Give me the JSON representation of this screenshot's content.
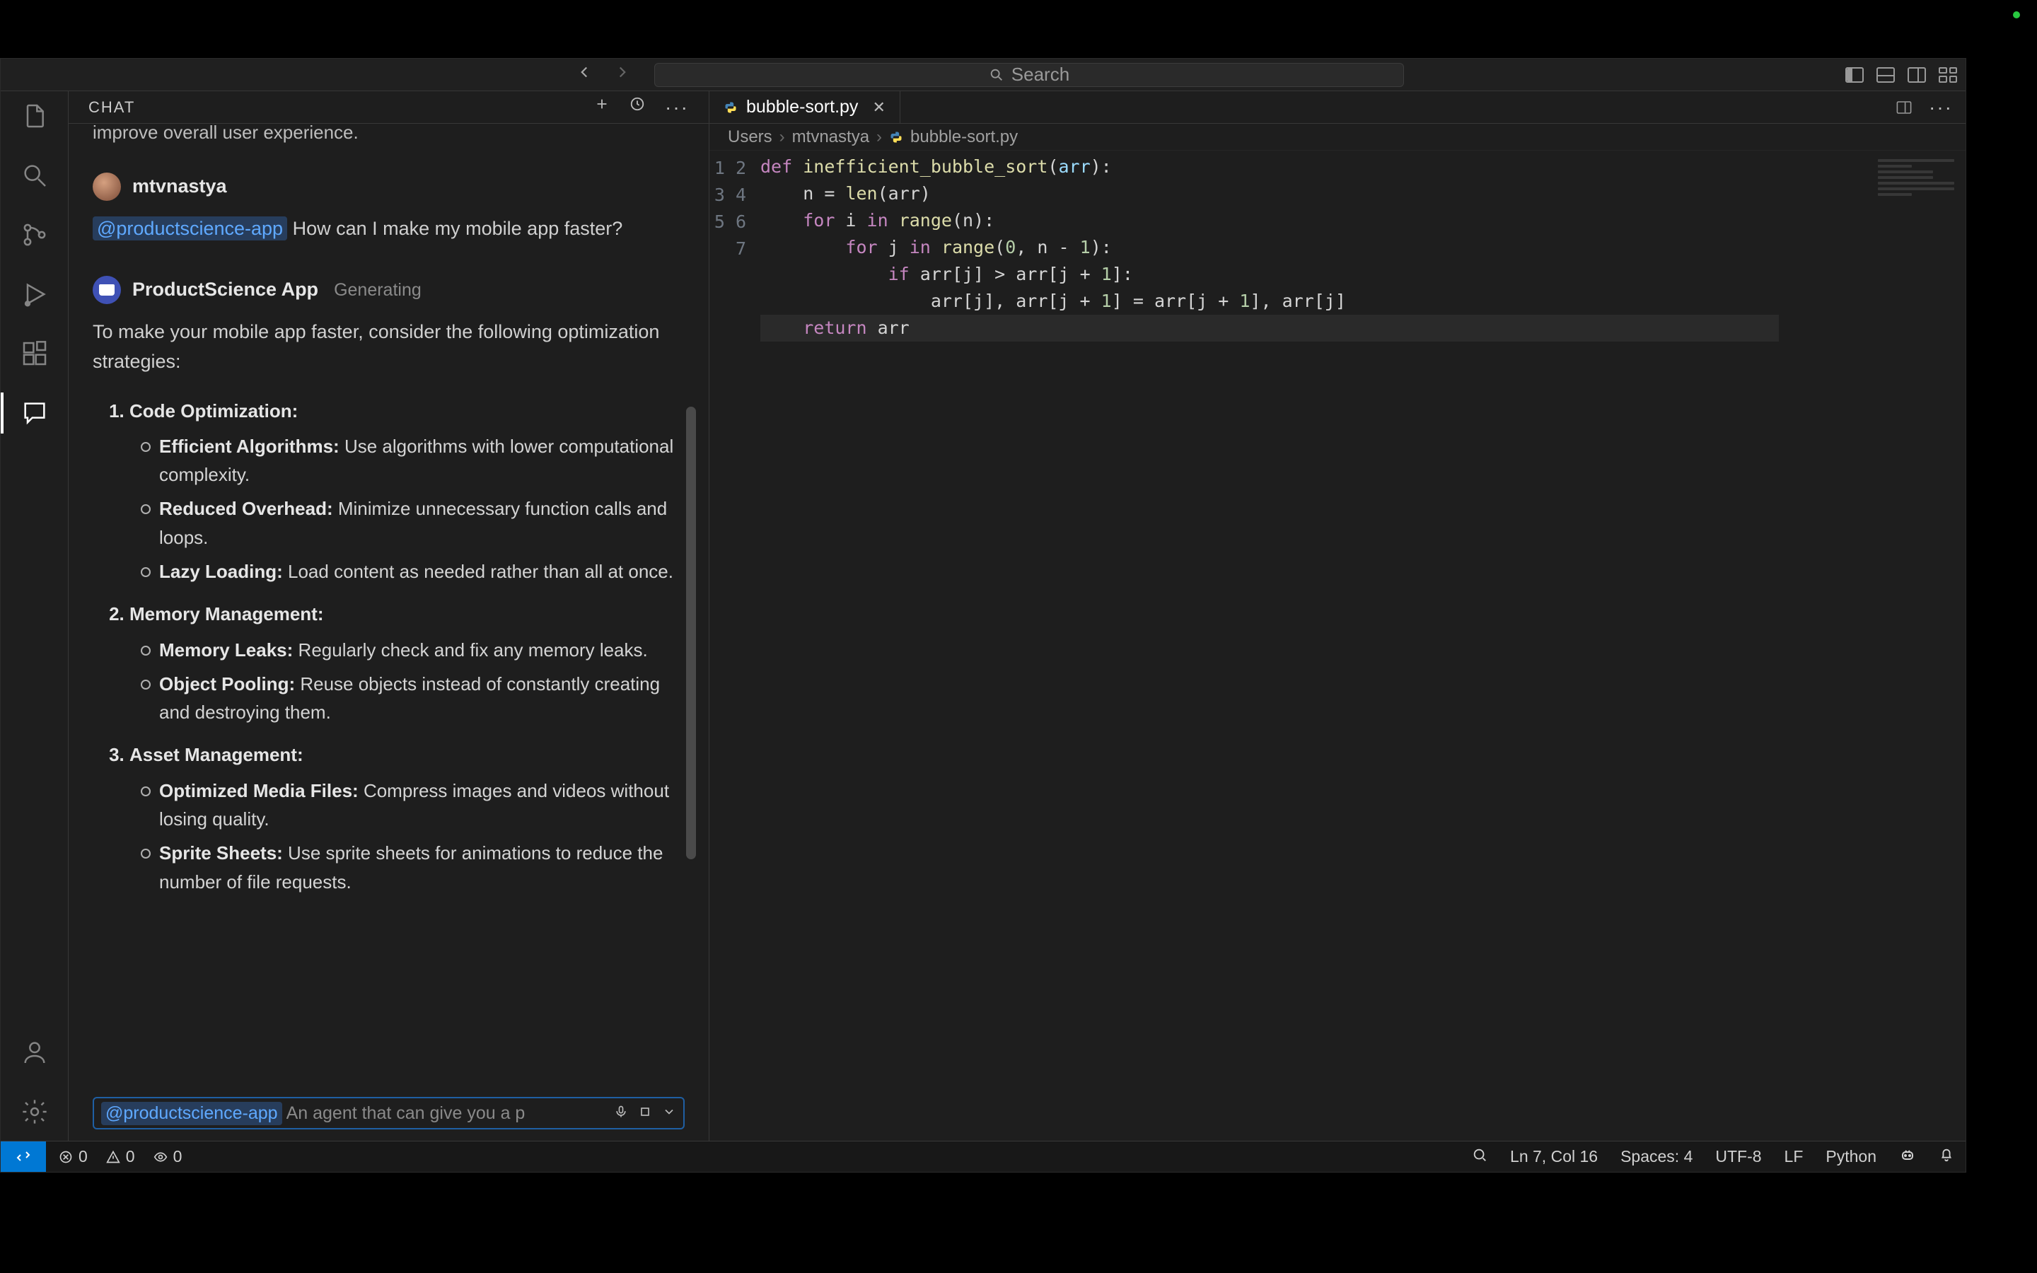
{
  "titlebar": {
    "search_placeholder": "Search"
  },
  "activity": {
    "items": [
      "explorer",
      "search",
      "source-control",
      "run-debug",
      "extensions",
      "chat"
    ],
    "active": "chat",
    "bottom": [
      "accounts",
      "settings"
    ]
  },
  "chat": {
    "header": "CHAT",
    "truncated": "improve overall user experience.",
    "user": {
      "name": "mtvnastya",
      "mention": "@productscience-app",
      "message": "How can I make my mobile app faster?"
    },
    "bot": {
      "name": "ProductScience App",
      "status": "Generating",
      "intro": "To make your mobile app faster, consider the following optimization strategies:",
      "sections": [
        {
          "title": "Code Optimization:",
          "items": [
            {
              "bold": "Efficient Algorithms:",
              "text": " Use algorithms with lower computational complexity."
            },
            {
              "bold": "Reduced Overhead:",
              "text": " Minimize unnecessary function calls and loops."
            },
            {
              "bold": "Lazy Loading:",
              "text": " Load content as needed rather than all at once."
            }
          ]
        },
        {
          "title": "Memory Management:",
          "items": [
            {
              "bold": "Memory Leaks:",
              "text": " Regularly check and fix any memory leaks."
            },
            {
              "bold": "Object Pooling:",
              "text": " Reuse objects instead of constantly creating and destroying them."
            }
          ]
        },
        {
          "title": "Asset Management:",
          "items": [
            {
              "bold": "Optimized Media Files:",
              "text": " Compress images and videos without losing quality."
            },
            {
              "bold": "Sprite Sheets:",
              "text": " Use sprite sheets for animations to reduce the number of file requests."
            }
          ]
        }
      ]
    },
    "input": {
      "mention": "@productscience-app",
      "placeholder": "An agent that can give you a p"
    }
  },
  "editor": {
    "tab": {
      "filename": "bubble-sort.py",
      "icon": "python-file-icon"
    },
    "breadcrumbs": [
      "Users",
      "mtvnastya",
      "bubble-sort.py"
    ],
    "code": {
      "lines": [
        "def inefficient_bubble_sort(arr):",
        "    n = len(arr)",
        "    for i in range(n):",
        "        for j in range(0, n - 1):",
        "            if arr[j] > arr[j + 1]:",
        "                arr[j], arr[j + 1] = arr[j + 1], arr[j]",
        "    return arr"
      ],
      "line_count": 7,
      "current_line": 7
    }
  },
  "status": {
    "errors": "0",
    "warnings": "0",
    "ports": "0",
    "cursor": "Ln 7, Col 16",
    "spaces": "Spaces: 4",
    "encoding": "UTF-8",
    "eol": "LF",
    "language": "Python"
  }
}
